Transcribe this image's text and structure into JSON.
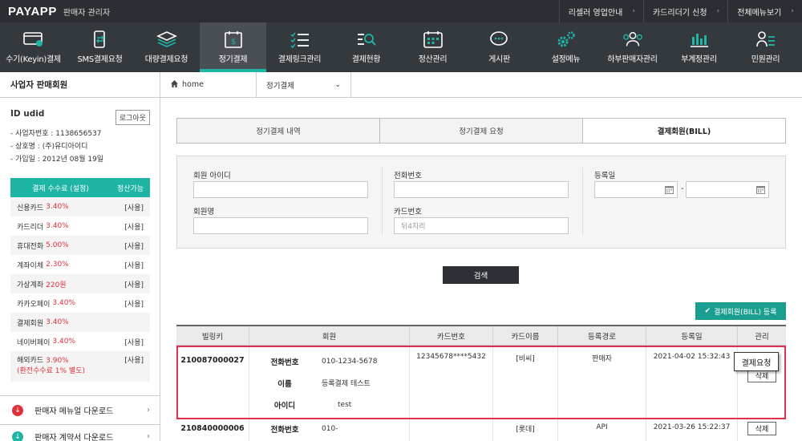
{
  "topbar": {
    "logo": "PAYAPP",
    "subtitle": "판매자 관리자",
    "links": [
      {
        "label": "리셀러 영업안내"
      },
      {
        "label": "카드리더기 신청"
      },
      {
        "label": "전체메뉴보기"
      }
    ]
  },
  "nav": {
    "items": [
      {
        "label": "수기(Keyin)결제",
        "icon": "card-terminal-icon"
      },
      {
        "label": "SMS결제요청",
        "icon": "phone-transfer-icon"
      },
      {
        "label": "대량결제요청",
        "icon": "layers-icon"
      },
      {
        "label": "정기결제",
        "icon": "calendar-money-icon",
        "active": true
      },
      {
        "label": "결제링크관리",
        "icon": "checklist-icon"
      },
      {
        "label": "결제현황",
        "icon": "search-list-icon"
      },
      {
        "label": "정산관리",
        "icon": "calendar-grid-icon"
      },
      {
        "label": "게시판",
        "icon": "chat-bubble-icon"
      },
      {
        "label": "설정메뉴",
        "icon": "gears-icon"
      },
      {
        "label": "하부판매자관리",
        "icon": "users-icon"
      },
      {
        "label": "부계정관리",
        "icon": "bar-chart-icon"
      },
      {
        "label": "민원관리",
        "icon": "person-list-icon"
      }
    ]
  },
  "sidebar": {
    "title": "사업자 판매회원",
    "user_id": "ID  udid",
    "logout": "로그아웃",
    "info": [
      "- 사업자번호 : 1138656537",
      "- 상호명 : (주)유디아이디",
      "- 가입일 : 2012년 08월 19일"
    ],
    "fee_header": {
      "col1": "결제 수수료 (설정)",
      "col2": "정산가능"
    },
    "fees": [
      {
        "name": "신용카드",
        "rate": "3.40%",
        "use": "[사용]"
      },
      {
        "name": "카드리더",
        "rate": "3.40%",
        "use": "[사용]"
      },
      {
        "name": "휴대전화",
        "rate": "5.00%",
        "use": "[사용]"
      },
      {
        "name": "계좌이체",
        "rate": "2.30%",
        "use": "[사용]"
      },
      {
        "name": "가상계좌",
        "rate": "220원",
        "use": "[사용]"
      },
      {
        "name": "카카오페이",
        "rate": "3.40%",
        "use": "[사용]"
      },
      {
        "name": "결제회원",
        "rate": "3.40%",
        "use": ""
      },
      {
        "name": "네이버페이",
        "rate": "3.40%",
        "use": "[사용]"
      },
      {
        "name": "해외카드",
        "rate": "3.90%",
        "use": "[사용]",
        "note": "(환전수수료 1% 별도)"
      }
    ],
    "downloads": [
      {
        "label": "판매자 메뉴얼 다운로드"
      },
      {
        "label": "판매자 계약서 다운로드"
      }
    ]
  },
  "breadcrumb": {
    "home": "home",
    "current": "정기결제"
  },
  "tabs": [
    {
      "label": "정기결제 내역"
    },
    {
      "label": "정기결제 요청"
    },
    {
      "label": "결제회원(BILL)",
      "active": true
    }
  ],
  "search": {
    "member_id_label": "회원 아이디",
    "phone_label": "전화번호",
    "reg_date_label": "등록일",
    "member_name_label": "회원명",
    "card_no_label": "카드번호",
    "card_no_placeholder": "뒤4자리",
    "search_button": "검색",
    "register_button": "결제회원(BILL) 등록"
  },
  "table": {
    "headers": [
      "빌링키",
      "회원",
      "카드번호",
      "카드이름",
      "등록경로",
      "등록일",
      "관리"
    ],
    "member_keys": {
      "phone": "전화번호",
      "name": "이름",
      "id": "아이디"
    },
    "rows": [
      {
        "billkey": "210087000027",
        "phone": "010-1234-5678",
        "name": "등록결제 테스트",
        "id": "test",
        "card_no": "12345678****5432",
        "card_name": "[비씨]",
        "route": "판매자",
        "reg_date": "2021-04-02 15:32:43",
        "delete": "삭제"
      },
      {
        "billkey": "210840000006",
        "phone": "010-",
        "card_name": "[롯데]",
        "route": "API",
        "reg_date": "2021-03-26 15:22:37",
        "delete": "삭제"
      }
    ]
  },
  "tooltip": "결제요청",
  "colors": {
    "accent": "#1eb5a5",
    "highlight": "#e0304a",
    "rate": "#e0303a"
  }
}
